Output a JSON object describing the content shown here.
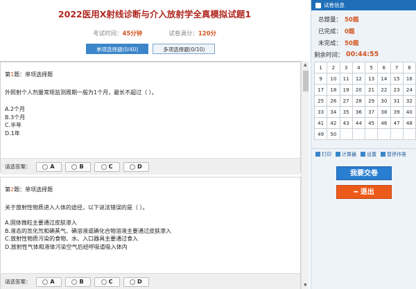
{
  "title": "2022医用X射线诊断与介入放射学全真模拟试题1",
  "meta": {
    "time_label": "考试时间：",
    "time_value": "45分钟",
    "score_label": "试卷满分：",
    "score_value": "120分"
  },
  "tabs": [
    {
      "label": "单项选择题(0/40)"
    },
    {
      "label": "多项选择题(0/10)"
    }
  ],
  "questions": [
    {
      "prefix": "第",
      "number": "1",
      "suffix": "题：单项选择题",
      "stem": "外照射个人剂量常规监测周期一般为1个月，最长不超过（  ）。",
      "options": [
        "A.2个月",
        "B.3个月",
        "C.半年",
        "D.1年"
      ]
    },
    {
      "prefix": "第",
      "number": "2",
      "suffix": "题：单项选择题",
      "stem": "关于放射性物质进入人体的途径，以下说法错误的是（  ）。",
      "options": [
        "A.固体微粒主要通过皮肤渗入",
        "B.液态的氚化氘和碘蒸气、碘溶液或碘化合物溶液主要通过皮肤渗入",
        "C.放射性物质污染的食物、水、入口器具主要通过食入",
        "D.放射性气体和液体污染空气后经呼吸道吸入体内"
      ]
    }
  ],
  "answer": {
    "label": "请选答案：",
    "choices": [
      "A",
      "B",
      "C",
      "D"
    ]
  },
  "panel": {
    "header": "试卷信息",
    "total_label": "总题量：",
    "total_value": "50题",
    "done_label": "已完成：",
    "done_value": "0题",
    "undone_label": "未完成：",
    "undone_value": "50题",
    "remain_label": "剩余时间：",
    "remain_value": "00:44:55"
  },
  "grid_numbers": [
    "1",
    "2",
    "3",
    "4",
    "5",
    "6",
    "7",
    "8",
    "9",
    "10",
    "11",
    "12",
    "13",
    "14",
    "15",
    "16",
    "17",
    "18",
    "19",
    "20",
    "21",
    "22",
    "23",
    "24",
    "25",
    "26",
    "27",
    "28",
    "29",
    "30",
    "31",
    "32",
    "33",
    "34",
    "35",
    "36",
    "37",
    "38",
    "39",
    "40",
    "41",
    "42",
    "43",
    "44",
    "45",
    "46",
    "47",
    "48",
    "49",
    "50"
  ],
  "tools": {
    "print": "打印",
    "calculator": "计算器",
    "settings": "设置",
    "pause": "暂停作答"
  },
  "submit_label": "我要交卷",
  "exit_label": "━ 退出",
  "colors": {
    "title": "#b0271f",
    "accent": "#d2541f",
    "primary": "#2a7ed2",
    "exit": "#ec5a1a"
  }
}
